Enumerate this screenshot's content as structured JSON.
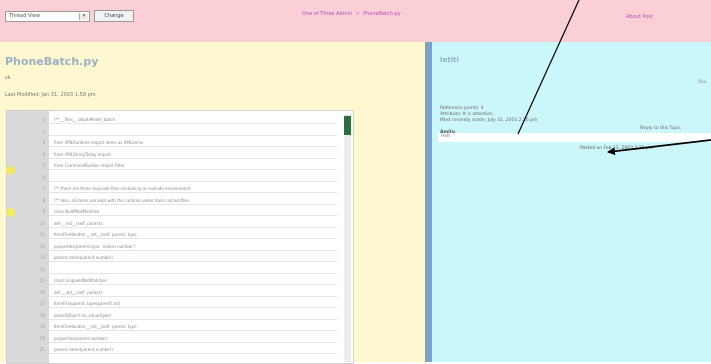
{
  "topbar": {
    "view_select_value": "Thread View",
    "change_button": "Change",
    "breadcrumbs": [
      "One of Three Admin",
      "»",
      "PhoneBatch.py"
    ],
    "about": "About Post"
  },
  "file": {
    "title": "PhoneBatch.py",
    "owner": "sk",
    "modified": "Last Modified: Jan 31, 2003 1:58 pm"
  },
  "code_lines": [
    {
      "n": "1",
      "t": "/** __files__ depthModel_batch"
    },
    {
      "n": "2",
      "t": ""
    },
    {
      "n": "3",
      "t": "from XMLRuntime import items as XMLitems"
    },
    {
      "n": "4",
      "t": "from XMLStringToday import"
    },
    {
      "n": "5",
      "t": "from CommandBuilder import Filter"
    },
    {
      "n": "6",
      "t": ""
    },
    {
      "n": "7",
      "t": "/** there are three separate files containing an outside environment"
    },
    {
      "n": "8",
      "t": "/** also, all items are kept with the runtime under item cached files"
    },
    {
      "n": "9",
      "t": "class NullIfNotMatches"
    },
    {
      "n": "10",
      "t": "    def __init__(self, parent):"
    },
    {
      "n": "11",
      "t": "        ItemFileHandler.__init__(self, parent, type"
    },
    {
      "n": "12",
      "t": "                properties(parent.type, 'extern number')"
    },
    {
      "n": "13",
      "t": "                parent.name(parent.number)"
    },
    {
      "n": "14",
      "t": ""
    },
    {
      "n": "15",
      "t": "class UniqueIdNotMatches"
    },
    {
      "n": "16",
      "t": "    def __init__(self, parent):"
    },
    {
      "n": "17",
      "t": "        ItemFile(parent, type(parent).str)"
    },
    {
      "n": "18",
      "t": "        parentObject.no_value(type)"
    },
    {
      "n": "19",
      "t": "        ItemFileHandler.__init__(self, parent, type"
    },
    {
      "n": "20",
      "t": "                properties(parent.number)"
    },
    {
      "n": "21",
      "t": "                parent.name(parent.number)"
    }
  ],
  "comment": {
    "title": "Ietitl",
    "corner": "Rxx",
    "meta": [
      "Reference points:  4",
      "Attribute:  It is attention",
      "Most recently made:  July 31, 2003 2:36 pm"
    ],
    "reply_link": "Reply to this Topic",
    "note_author": "Amito",
    "note_text": "Helt",
    "footer": "Posted on Feb 13, 2003 2:18 pm"
  },
  "colors": {
    "topbar": "#fbcfd6",
    "left_panel": "#fdf8cf",
    "right_panel": "#ccf7fa",
    "divider": "#7ba2c9",
    "link": "#b44bc3",
    "marker": "#f3ea66"
  }
}
